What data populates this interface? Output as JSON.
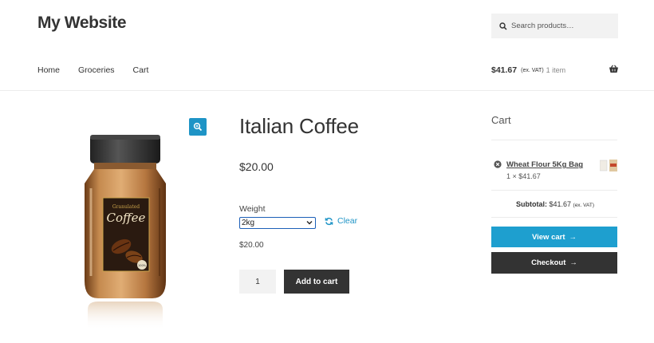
{
  "site": {
    "title": "My Website"
  },
  "search": {
    "placeholder": "Search products…",
    "icon": "search-icon"
  },
  "nav": {
    "items": [
      {
        "label": "Home"
      },
      {
        "label": "Groceries"
      },
      {
        "label": "Cart"
      }
    ]
  },
  "header_cart": {
    "amount": "$41.67",
    "vat": "(ex. VAT)",
    "count": "1 item",
    "icon": "basket-icon"
  },
  "product": {
    "title": "Italian Coffee",
    "price": "$20.00",
    "image": {
      "label_top": "Granulated",
      "label_main": "Coffee",
      "badge": "100%"
    },
    "variation": {
      "label": "Weight",
      "selected": "2kg",
      "clear_label": "Clear",
      "price": "$20.00"
    },
    "quantity": "1",
    "add_to_cart_label": "Add to cart"
  },
  "mini_cart": {
    "title": "Cart",
    "items": [
      {
        "name": "Wheat Flour 5Kg Bag",
        "qty_price": "1 × $41.67"
      }
    ],
    "subtotal_label": "Subtotal:",
    "subtotal_value": "$41.67",
    "subtotal_vat": "(ex. VAT)",
    "view_cart_label": "View cart",
    "checkout_label": "Checkout"
  },
  "colors": {
    "accent": "#1e9fcf",
    "dark": "#333333"
  }
}
